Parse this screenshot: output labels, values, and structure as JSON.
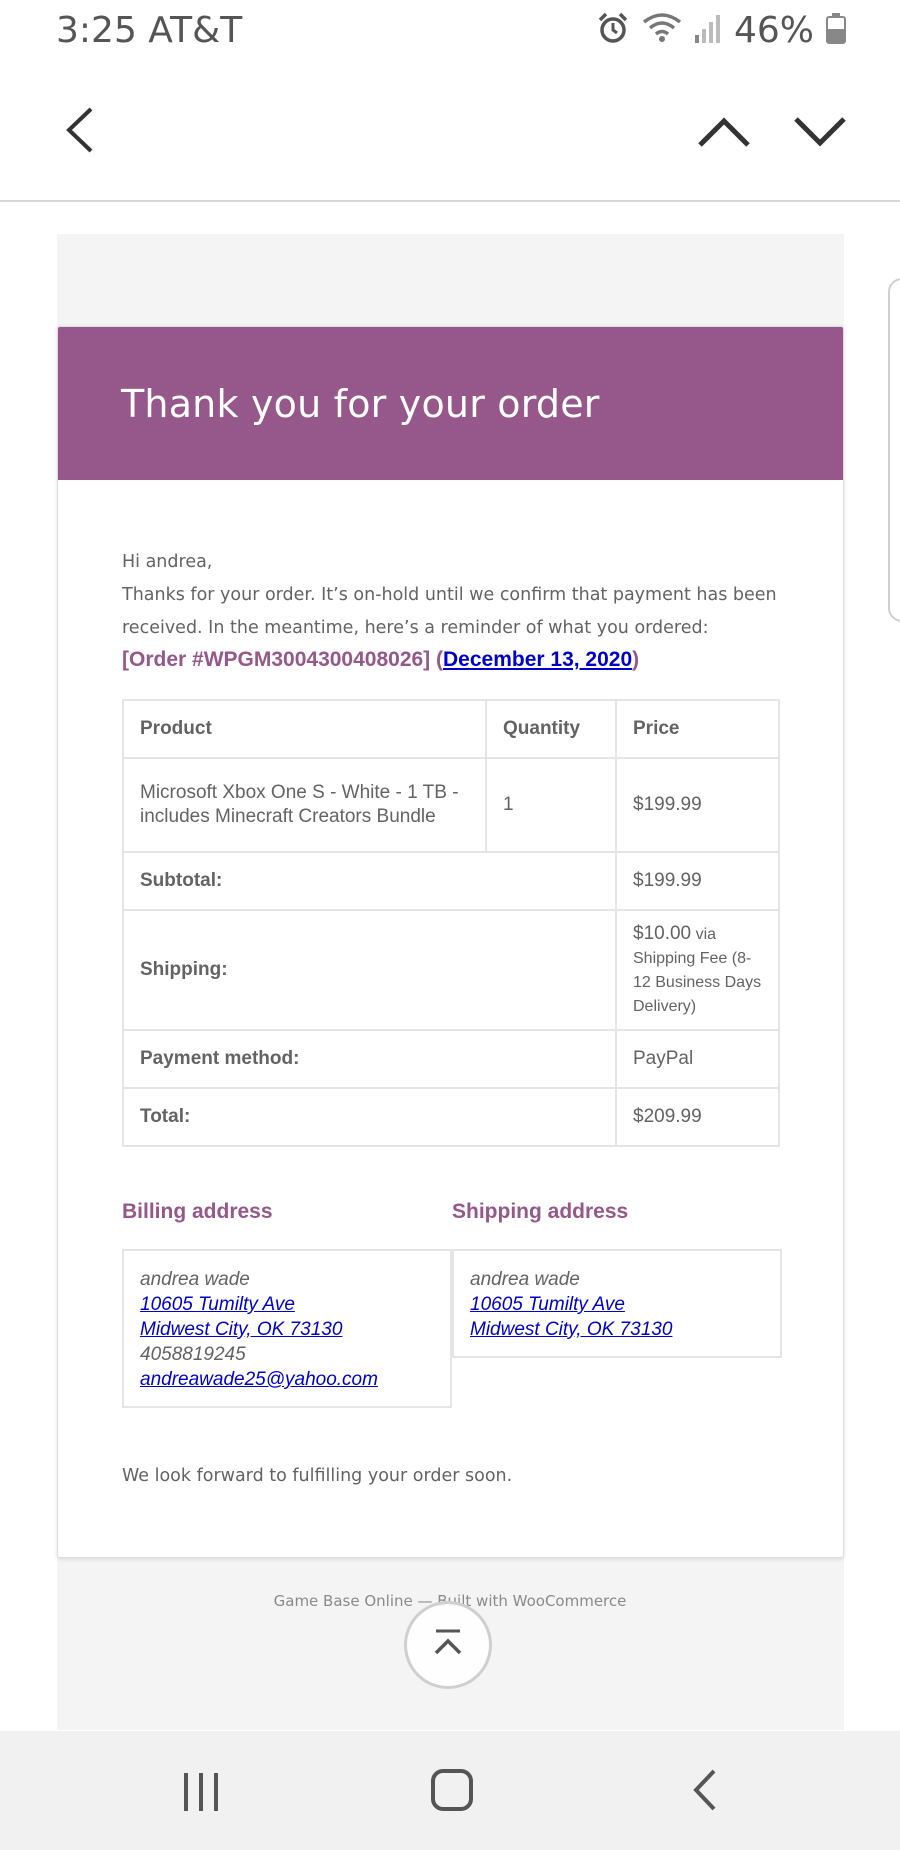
{
  "status_bar": {
    "time": "3:25",
    "carrier": "AT&T",
    "battery": "46%"
  },
  "email": {
    "header_title": "Thank you for your order",
    "greeting": "Hi andrea,",
    "intro": "Thanks for your order. It’s on-hold until we confirm that payment has been received. In the meantime, here’s a reminder of what you ordered:",
    "order_prefix": "[Order #WPGM3004300408026] (",
    "order_date": "December 13, 2020",
    "order_suffix": ")",
    "table": {
      "headers": [
        "Product",
        "Quantity",
        "Price"
      ],
      "items": [
        {
          "product": "Microsoft Xbox One S - White - 1 TB - includes Minecraft Creators Bundle",
          "quantity": "1",
          "price": "$199.99"
        }
      ],
      "subtotal_label": "Subtotal:",
      "subtotal_value": "$199.99",
      "shipping_label": "Shipping:",
      "shipping_amount": "$10.00",
      "shipping_method": " via Shipping Fee (8-12 Business Days Delivery)",
      "payment_label": "Payment method:",
      "payment_value": "PayPal",
      "total_label": "Total:",
      "total_value": "$209.99"
    },
    "billing": {
      "title": "Billing address",
      "name": "andrea wade",
      "street": "10605 Tumilty Ave",
      "city": "Midwest City, OK 73130",
      "phone": "4058819245",
      "email": "andreawade25@yahoo.com"
    },
    "shipping": {
      "title": "Shipping address",
      "name": "andrea wade",
      "street": "10605 Tumilty Ave",
      "city": "Midwest City, OK 73130"
    },
    "closing": "We look forward to fulfilling your order soon.",
    "footer": "Game Base Online — Built with WooCommerce"
  },
  "colors": {
    "brand": "#96588a",
    "link": "#0000cc",
    "text": "#636363"
  },
  "icons": [
    "alarm-icon",
    "wifi-icon",
    "signal-icon",
    "battery-icon",
    "back-icon",
    "previous-icon",
    "next-icon",
    "scroll-top-icon",
    "recents-icon",
    "home-icon",
    "nav-back-icon"
  ]
}
